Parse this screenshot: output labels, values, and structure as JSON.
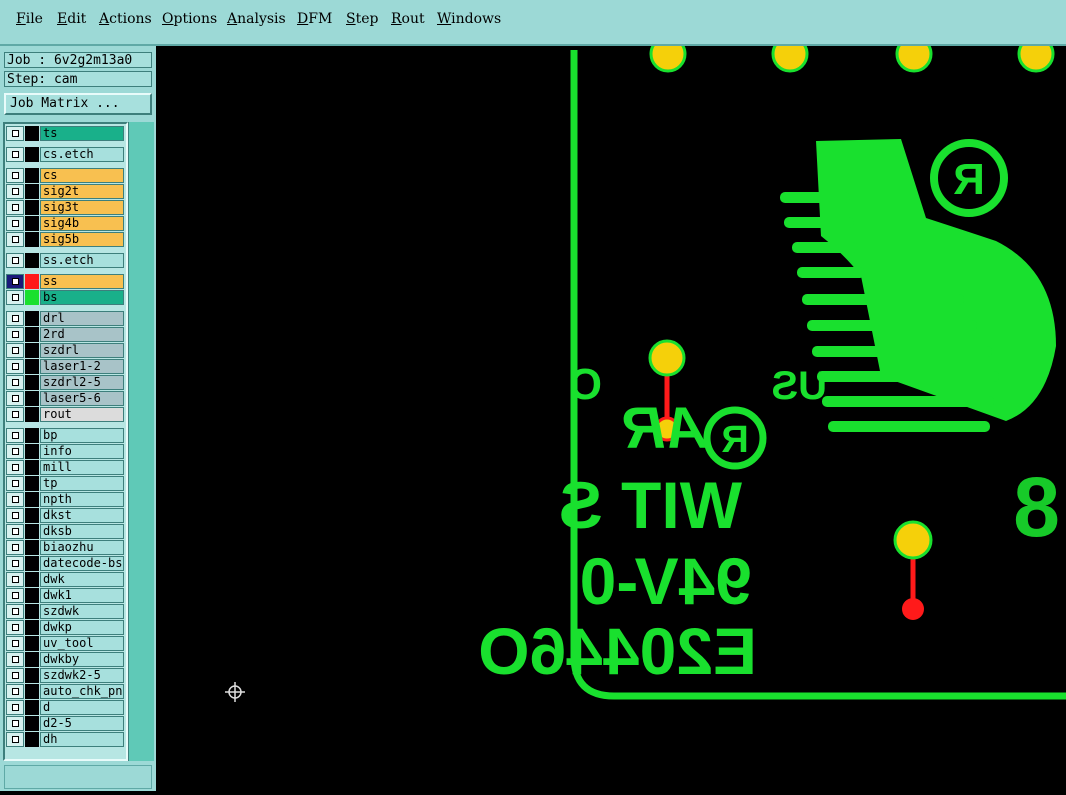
{
  "menu": {
    "items": [
      "File",
      "Edit",
      "Actions",
      "Options",
      "Analysis",
      "DFM",
      "Step",
      "Rout",
      "Windows"
    ]
  },
  "job": {
    "label": "Job :",
    "name": "6v2g2m13a0"
  },
  "step": {
    "label": "Step:",
    "name": "cam"
  },
  "job_matrix_label": "Job Matrix ...",
  "colors": {
    "board": "#000000",
    "copper": "#19e02e",
    "pad": "#f5d00a",
    "drill": "#ff1a1a",
    "panel": "#9cd9d6",
    "signal_layer": "#f8c050",
    "mask_layer": "#19b08a",
    "drill_layer": "#a8c3c8",
    "doc_layer": "#a7e0dd"
  },
  "layers": [
    {
      "name": "ts",
      "type": "mask",
      "color": "#19b08a"
    },
    {
      "name": "cs.etch",
      "type": "doc",
      "color": "#a7e0dd"
    },
    {
      "name": "cs",
      "type": "signal",
      "color": "#f8c050"
    },
    {
      "name": "sig2t",
      "type": "signal",
      "color": "#f8c050"
    },
    {
      "name": "sig3t",
      "type": "signal",
      "color": "#f8c050"
    },
    {
      "name": "sig4b",
      "type": "signal",
      "color": "#f8c050"
    },
    {
      "name": "sig5b",
      "type": "signal",
      "color": "#f8c050"
    },
    {
      "name": "ss.etch",
      "type": "doc",
      "color": "#a7e0dd"
    },
    {
      "name": "ss",
      "type": "signal",
      "color": "#f8c050",
      "active": true,
      "swatch": "#ff1a1a"
    },
    {
      "name": "bs",
      "type": "mask",
      "color": "#19b08a",
      "swatch": "#19e02e"
    },
    {
      "name": "drl",
      "type": "drill",
      "color": "#a8c3c8"
    },
    {
      "name": "2rd",
      "type": "drill",
      "color": "#a8c3c8"
    },
    {
      "name": "szdrl",
      "type": "drill",
      "color": "#a8c3c8"
    },
    {
      "name": "laser1-2",
      "type": "drill",
      "color": "#a8c3c8"
    },
    {
      "name": "szdrl2-5",
      "type": "drill",
      "color": "#a8c3c8"
    },
    {
      "name": "laser5-6",
      "type": "drill",
      "color": "#a8c3c8"
    },
    {
      "name": "rout",
      "type": "rout",
      "color": "#dcdcdc"
    },
    {
      "name": "bp",
      "type": "doc",
      "color": "#a7e0dd"
    },
    {
      "name": "info",
      "type": "doc",
      "color": "#a7e0dd"
    },
    {
      "name": "mill",
      "type": "doc",
      "color": "#a7e0dd"
    },
    {
      "name": "tp",
      "type": "doc",
      "color": "#a7e0dd"
    },
    {
      "name": "npth",
      "type": "doc",
      "color": "#a7e0dd"
    },
    {
      "name": "dkst",
      "type": "doc",
      "color": "#a7e0dd"
    },
    {
      "name": "dksb",
      "type": "doc",
      "color": "#a7e0dd"
    },
    {
      "name": "biaozhu",
      "type": "doc",
      "color": "#a7e0dd"
    },
    {
      "name": "datecode-bs",
      "type": "doc",
      "color": "#a7e0dd"
    },
    {
      "name": "dwk",
      "type": "doc",
      "color": "#a7e0dd"
    },
    {
      "name": "dwk1",
      "type": "doc",
      "color": "#a7e0dd"
    },
    {
      "name": "szdwk",
      "type": "doc",
      "color": "#a7e0dd"
    },
    {
      "name": "dwkp",
      "type": "doc",
      "color": "#a7e0dd"
    },
    {
      "name": "uv_tool",
      "type": "doc",
      "color": "#a7e0dd"
    },
    {
      "name": "dwkby",
      "type": "doc",
      "color": "#a7e0dd"
    },
    {
      "name": "szdwk2-5",
      "type": "doc",
      "color": "#a7e0dd"
    },
    {
      "name": "auto_chk_pn",
      "type": "doc",
      "color": "#a7e0dd"
    },
    {
      "name": "d",
      "type": "doc",
      "color": "#a7e0dd"
    },
    {
      "name": "d2-5",
      "type": "doc",
      "color": "#a7e0dd"
    },
    {
      "name": "dh",
      "type": "doc",
      "color": "#a7e0dd"
    }
  ],
  "silkscreen": {
    "line1": "E20446O",
    "line2": "94V-0",
    "line3": "WIT S",
    "logo_text": "AR",
    "c_mark": "C",
    "us_mark": "US",
    "registered": "R",
    "digit": "8"
  }
}
